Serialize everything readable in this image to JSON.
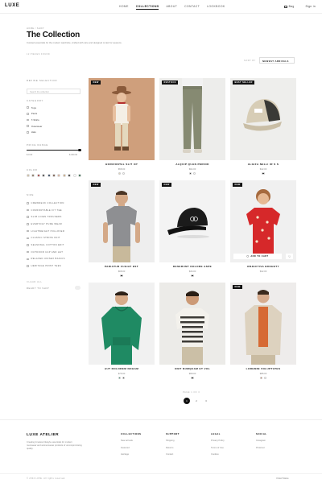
{
  "header": {
    "logo": "LUXE",
    "nav": [
      "HOME",
      "COLLECTIONS",
      "ABOUT",
      "CONTACT",
      "LOOKBOOK"
    ],
    "bag_label": "Bag",
    "signin_label": "Sign in"
  },
  "page": {
    "breadcrumb": "HOME / SHOP",
    "title": "The Collection",
    "description": "Curated essentials for the modern wardrobe, crafted with care and designed to last for seasons.",
    "count": "12 PIECES FOUND",
    "sort_label": "SORT BY",
    "sort_value": "NEWEST ARRIVALS"
  },
  "sidebar": {
    "search_heading": "REFINE SELECTION",
    "search_placeholder": "Search the collection",
    "category_heading": "CATEGORY",
    "categories": [
      "Tops",
      "Pants",
      "T-Shirts",
      "Outerwear",
      "Hats"
    ],
    "price_heading": "PRICE RANGE",
    "price_min": "$ 0.00",
    "price_max": "$ 300.00",
    "color_heading": "COLOR",
    "colors": [
      "#c9b89a",
      "#7d6a52",
      "#9c2a2a",
      "#3a3a3a",
      "#1f3550",
      "#6b4a3a",
      "#d4a690",
      "#c7a27a",
      "#2a2a2a",
      "#ffffff",
      "#1f5c3a"
    ],
    "size_heading": "SIZE",
    "sizes": [
      "CREWNECK COLLECTION",
      "COMFORTABLE FIT TEE",
      "SLIM LINEN TROUSERS",
      "EVERYDAY PURE WEAR",
      "LIGHTWEIGHT PULLOVER",
      "CLASSIC STRIPE KNIT",
      "SEASONAL COTTON EDIT",
      "OUTDOOR CAP AND HAT",
      "RELAXED UNISEX BASICS",
      "HERITAGE PRINT TEES"
    ],
    "clear_label": "CLEAR ALL",
    "ready_label": "READY TO SHIP"
  },
  "products": [
    {
      "badge": "NEW",
      "name": "HORIZONTAL SLIT UP",
      "price": "$58.00",
      "colors": [
        "#e8d7b0",
        "#ffffff"
      ]
    },
    {
      "badge": "RESTOCK",
      "name": "ALQUIP QUAN PERIOD",
      "price": "$94.00",
      "colors": [
        "#222222",
        "#ffffff"
      ]
    },
    {
      "badge": "BEST SELLER",
      "name": "ALGIZA NELLI IR S S",
      "price": "$42.00",
      "colors": [
        "#222222"
      ]
    },
    {
      "badge": "NEW",
      "name": "PARIATUR FUGIAT EST",
      "price": "$68.00",
      "colors": [
        "#222222"
      ]
    },
    {
      "badge": "NEW",
      "name": "DESERUNT DOLORE ASPE",
      "price": "$36.00",
      "colors": [
        "#222222"
      ]
    },
    {
      "badge": "NEW",
      "name": "OBJECTIVA EROHETY",
      "price": "$32.00",
      "colors": [],
      "add_to_cart": "ADD TO CART"
    },
    {
      "badge": "",
      "name": "AUT DOLOREM NOHAM",
      "price": "$76.00",
      "colors": [
        "#1f7a55",
        "#222222"
      ]
    },
    {
      "badge": "",
      "name": "UNIT NUMQUAM ET VOL",
      "price": "$58.00",
      "colors": [
        "#222222"
      ]
    },
    {
      "badge": "NEW",
      "name": "LOREMIN VOLUPTATES",
      "price": "$88.00",
      "colors": [
        "#d0673a",
        "#ffffff"
      ]
    }
  ],
  "pagination": {
    "label": "PAGE 1 OF 3",
    "pages": [
      "1",
      "2",
      "3"
    ]
  },
  "footer": {
    "brand": "LUXE ATELIER",
    "description": "Creating timeless lifestyle essentials for modern menswear and womenswear products of uncompromising quality.",
    "columns": [
      {
        "heading": "COLLECTIONS",
        "links": [
          "New arrivals",
          "Featured",
          "Heritage"
        ]
      },
      {
        "heading": "SUPPORT",
        "links": [
          "Shipping",
          "Returns",
          "Contact"
        ]
      },
      {
        "heading": "LEGAL",
        "links": [
          "Privacy Policy",
          "Terms of Use",
          "Cookies"
        ]
      },
      {
        "heading": "SOCIAL",
        "links": [
          "Instagram",
          "Pinterest"
        ]
      }
    ],
    "copyright": "© 2024 LUXE. All rights reserved.",
    "language": "United States"
  }
}
